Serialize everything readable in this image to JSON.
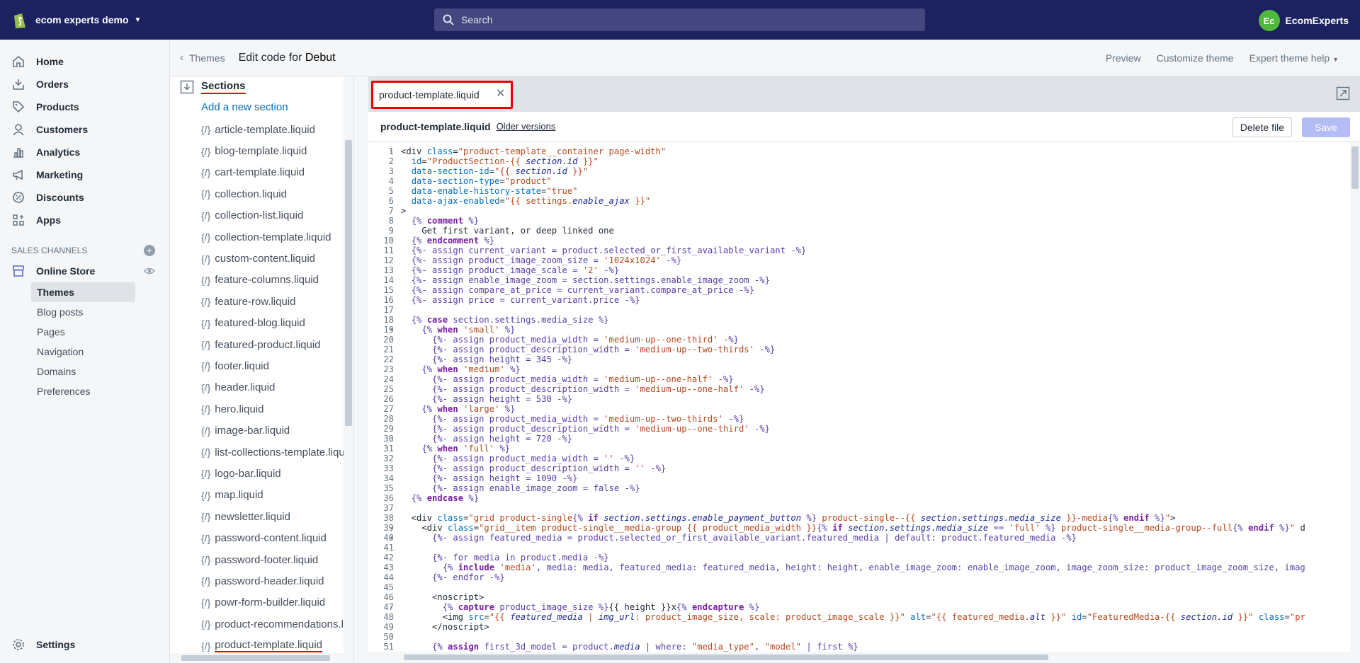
{
  "store": {
    "name": "ecom experts demo"
  },
  "search": {
    "placeholder": "Search"
  },
  "user": {
    "initials": "Ec",
    "name": "EcomExperts"
  },
  "nav": {
    "items": [
      {
        "label": "Home",
        "icon": "home-icon"
      },
      {
        "label": "Orders",
        "icon": "orders-icon"
      },
      {
        "label": "Products",
        "icon": "tag-icon"
      },
      {
        "label": "Customers",
        "icon": "person-icon"
      },
      {
        "label": "Analytics",
        "icon": "bar-chart-icon"
      },
      {
        "label": "Marketing",
        "icon": "megaphone-icon"
      },
      {
        "label": "Discounts",
        "icon": "discount-icon"
      },
      {
        "label": "Apps",
        "icon": "apps-icon"
      }
    ],
    "channels_heading": "SALES CHANNELS",
    "online_store": "Online Store",
    "sub_items": [
      "Themes",
      "Blog posts",
      "Pages",
      "Navigation",
      "Domains",
      "Preferences"
    ],
    "settings": "Settings"
  },
  "breadcrumb": {
    "back": "Themes",
    "title_prefix": "Edit code for ",
    "theme": "Debut"
  },
  "header_actions": {
    "preview": "Preview",
    "customize": "Customize theme",
    "expert": "Expert theme help"
  },
  "sections": {
    "title": "Sections",
    "add_link": "Add a new section",
    "files": [
      "article-template.liquid",
      "blog-template.liquid",
      "cart-template.liquid",
      "collection.liquid",
      "collection-list.liquid",
      "collection-template.liquid",
      "custom-content.liquid",
      "feature-columns.liquid",
      "feature-row.liquid",
      "featured-blog.liquid",
      "featured-product.liquid",
      "footer.liquid",
      "header.liquid",
      "hero.liquid",
      "image-bar.liquid",
      "list-collections-template.liquid",
      "logo-bar.liquid",
      "map.liquid",
      "newsletter.liquid",
      "password-content.liquid",
      "password-footer.liquid",
      "password-header.liquid",
      "powr-form-builder.liquid",
      "product-recommendations.liquid",
      "product-template.liquid"
    ],
    "active_file": "product-template.liquid"
  },
  "editor": {
    "tab_label": "product-template.liquid",
    "file_name": "product-template.liquid",
    "older_versions": "Older versions",
    "delete_label": "Delete file",
    "save_label": "Save"
  },
  "colors": {
    "topbar": "#1c2260",
    "accent_red": "#ee0000",
    "link": "#006fbb",
    "save_disabled": "#b3bcf5"
  }
}
